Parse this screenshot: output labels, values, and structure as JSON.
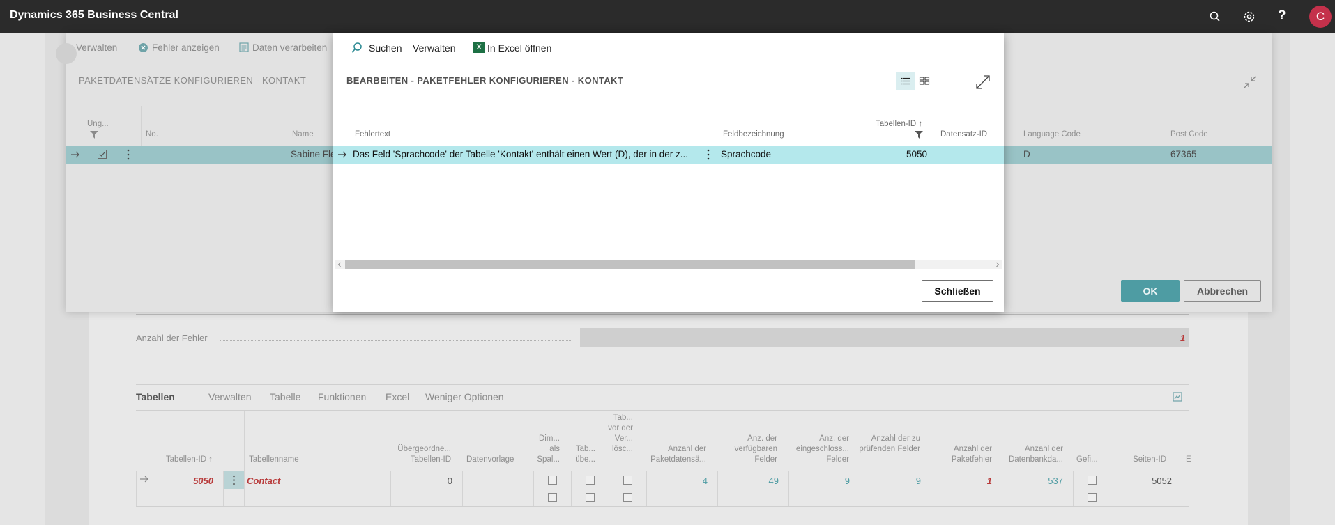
{
  "app": {
    "title": "Dynamics 365 Business Central",
    "user_initial": "C"
  },
  "icons": [
    "search-icon",
    "gear-icon",
    "help-icon",
    "avatar",
    "error-icon",
    "process-icon",
    "excel-icon",
    "list-view-icon",
    "tile-view-icon",
    "expand-icon",
    "collapse-icon",
    "filter-icon",
    "arrow-icon",
    "more-icon",
    "share-icon"
  ],
  "background_page": {
    "error_count_label": "Anzahl der Fehler",
    "error_count": "1",
    "tabs": [
      "Tabellen",
      "Verwalten",
      "Tabelle",
      "Funktionen",
      "Excel",
      "Weniger Optionen"
    ],
    "columns": [
      "Tabellen-ID ↑",
      "Tabellenname",
      "Übergeordne... Tabellen-ID",
      "Datenvorlage",
      "Dim... als Spal...",
      "Tab... übe...",
      "Tab... vor der Ver... lösc...",
      "Anzahl der Paketdatensä...",
      "Anz. der verfügbaren Felder",
      "Anz. der eingeschloss... Felder",
      "Anzahl der zu prüfenden Felder",
      "Anzahl der Paketfehler",
      "Anzahl der Datenbankda...",
      "Gefi...",
      "Seiten-ID",
      "E"
    ],
    "row": {
      "table_id": "5050",
      "table_name": "Contact",
      "parent_table_id": "0",
      "pkg_records": "4",
      "available_fields": "49",
      "included_fields": "9",
      "fields_to_validate": "9",
      "pkg_errors": "1",
      "db_records": "537",
      "page_id": "5052"
    }
  },
  "records_dialog": {
    "actions": [
      "Verwalten",
      "Fehler anzeigen",
      "Daten verarbeiten"
    ],
    "title": "PAKETDATENSÄTZE KONFIGURIEREN - KONTAKT",
    "columns": {
      "invalid": "Ung...",
      "no": "No.",
      "name": "Name",
      "language_code": "Language Code",
      "post_code": "Post Code"
    },
    "row": {
      "name": "Sabine Fle",
      "language_code": "D",
      "post_code": "67365"
    },
    "ok_label": "OK",
    "cancel_label": "Abbrechen"
  },
  "errors_dialog": {
    "actions": [
      "Suchen",
      "Verwalten",
      "In Excel öffnen"
    ],
    "title": "BEARBEITEN - PAKETFEHLER KONFIGURIEREN - KONTAKT",
    "columns": {
      "error_text": "Fehlertext",
      "field_caption": "Feldbezeichnung",
      "table_id": "Tabellen-ID ↑",
      "record_id": "Datensatz-ID"
    },
    "row": {
      "error_text": "Das Feld 'Sprachcode' der Tabelle 'Kontakt' enthält einen Wert (D), der in der z...",
      "field_caption": "Sprachcode",
      "table_id": "5050",
      "record_id": "_"
    },
    "close_label": "Schließen"
  }
}
